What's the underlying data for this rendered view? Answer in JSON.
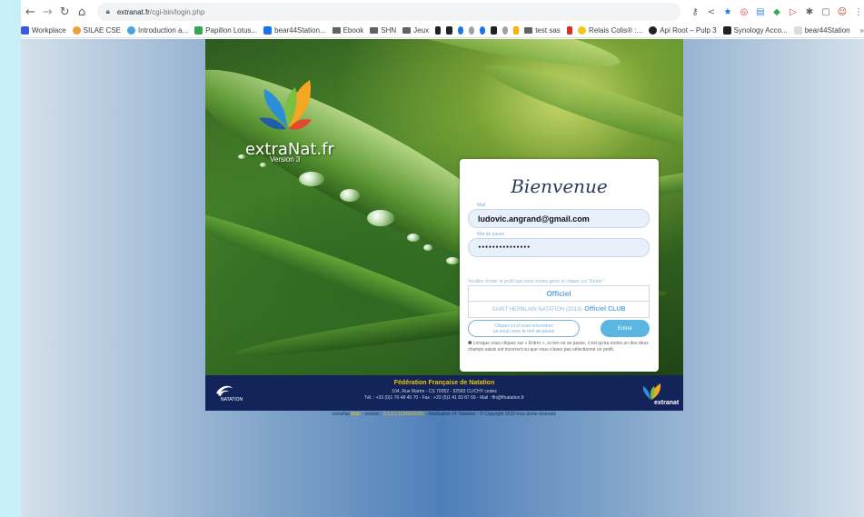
{
  "browser": {
    "url_host": "extranat.fr",
    "url_path": "/cgi-bin/login.php",
    "bookmarks": [
      {
        "label": "Workplace",
        "color": "#3b5bdb"
      },
      {
        "label": "SILAE CSE",
        "color": "#e8a23a"
      },
      {
        "label": "Introduction a...",
        "color": "#4aa3df"
      },
      {
        "label": "Papillon Lotus...",
        "color": "#34a853"
      },
      {
        "label": "bear44Station...",
        "color": "#1a73e8"
      },
      {
        "label": "Ebook",
        "color": "folder"
      },
      {
        "label": "SHN",
        "color": "folder"
      },
      {
        "label": "Jeux",
        "color": "folder"
      },
      {
        "label": "test sas",
        "color": "folder"
      },
      {
        "label": "Relais Colis® :...",
        "color": "#f5c518"
      },
      {
        "label": "Api Root – Pulp 3",
        "color": "#202124"
      },
      {
        "label": "Synology Acco...",
        "color": "#202124"
      },
      {
        "label": "bear44Station",
        "color": "#dadce0"
      }
    ],
    "overflow": "»"
  },
  "hero": {
    "brand": "extraNat.fr",
    "version": "Version 3"
  },
  "login": {
    "title": "Bienvenue",
    "mail_label": "Mail",
    "mail_value": "ludovic.angrand@gmail.com",
    "password_label": "Mot de passe",
    "password_value": "•••••••••••••••",
    "profile_help": "Veuillez choisir le profil que vous voulez gérer et cliquer sur \"Entrer\"",
    "profile_header": "Officiel",
    "profile_club": "SAINT HERBLAIN NATATION (2013)",
    "profile_badge": "Officiel CLUB",
    "forgot_line1": "Cliquez ici si vous rencontrez",
    "forgot_line2": "un souci avec le mot de passe",
    "enter_label": "Entrer",
    "note": "Lorsque vous cliquez sur « Entrer », si rien ne se passe, c'est qu'au moins un des deux champs saisis est incorrect ou que vous n'avez pas sélectionné un profil."
  },
  "footer": {
    "title": "Fédération Française de Natation",
    "address": "104, Rue Martre - CS 70052 - 92583 CLICHY cedex",
    "contact": "Tél. : +33 (0)1 70 48 45 70 - Fax : +33 (0)1 41 83 87 69 - Mail : ffn@ffnatation.fr",
    "ffn_logo_text": "NATATION",
    "extranat_logo_text": "extranat"
  },
  "copyright": {
    "prefix": "extraNat",
    "hl": "Main",
    "mid": "- version :",
    "version": "3.1.3.1 (13/09/2020)",
    "suffix": "- Réalisation FF Natation - © Copyright 2020 tous droits réservés"
  },
  "colors": {
    "accent": "#5ab5e0",
    "footer_bg": "#13245a",
    "footer_title": "#f0c400"
  }
}
